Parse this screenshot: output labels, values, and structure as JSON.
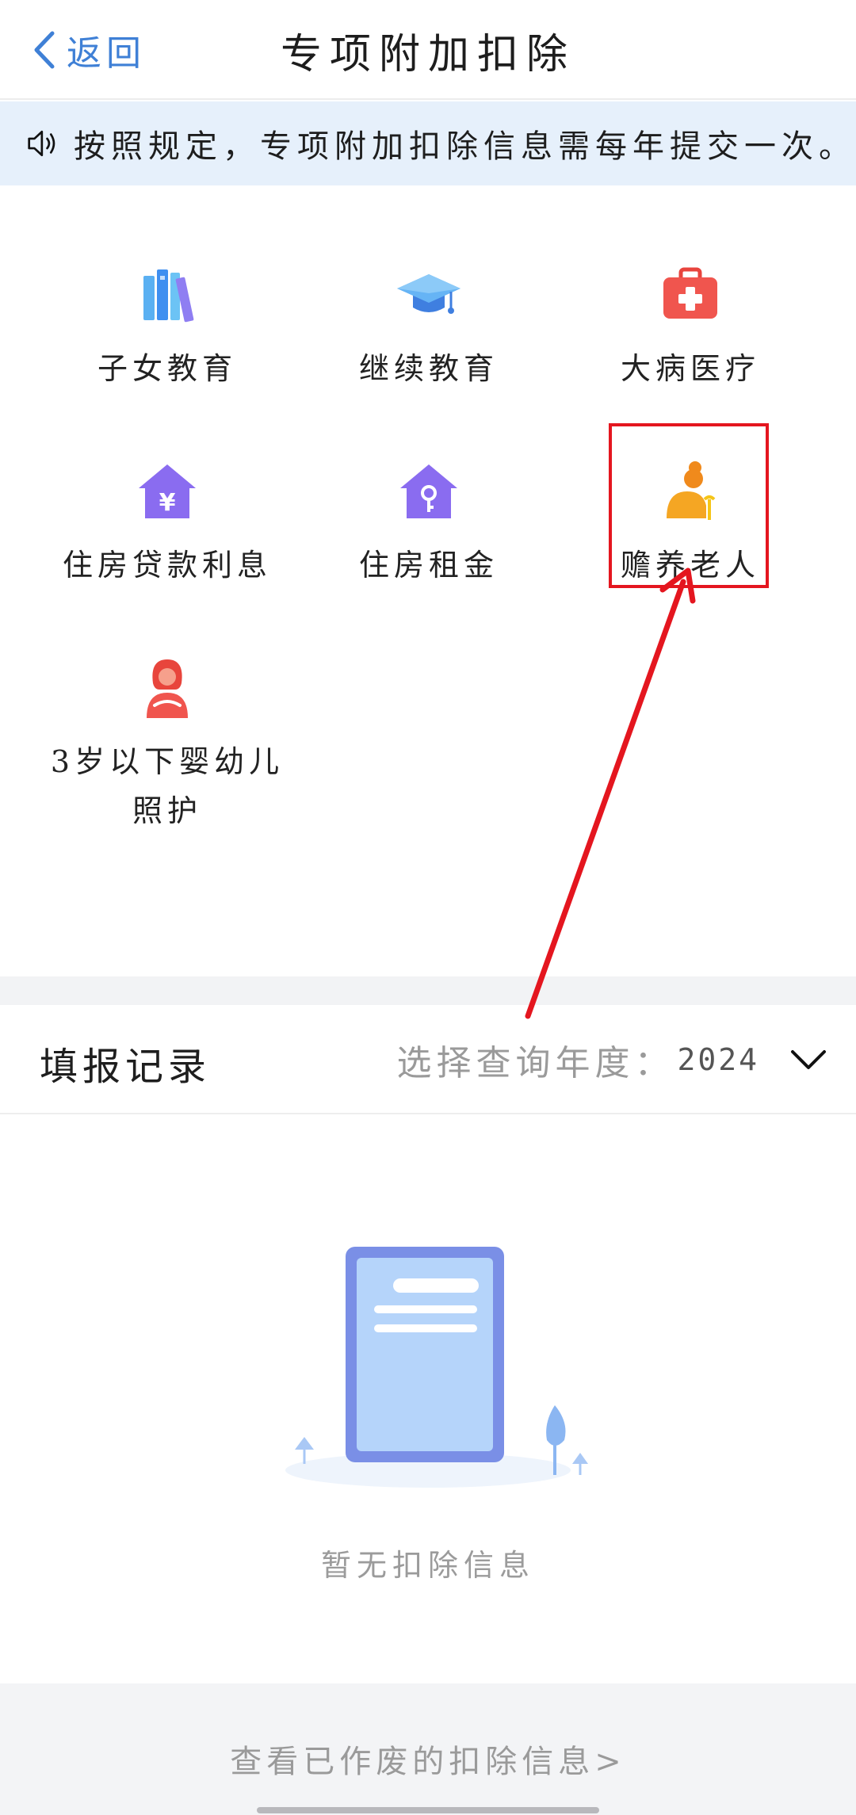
{
  "nav": {
    "back_label": "返回",
    "title": "专项附加扣除"
  },
  "notice": {
    "icon": "speaker-icon",
    "text": "按照规定，专项附加扣除信息需每年提交一次。"
  },
  "categories": [
    {
      "label": "子女教育",
      "icon": "books-icon",
      "color": "#4aa3f0"
    },
    {
      "label": "继续教育",
      "icon": "graduation-cap-icon",
      "color": "#4f8ff0"
    },
    {
      "label": "大病医疗",
      "icon": "medical-kit-icon",
      "color": "#f0554e"
    },
    {
      "label": "住房贷款利息",
      "icon": "house-yuan-icon",
      "color": "#8a6cf0"
    },
    {
      "label": "住房租金",
      "icon": "house-key-icon",
      "color": "#8a6cf0"
    },
    {
      "label": "赡养老人",
      "icon": "elderly-person-icon",
      "color": "#f5a623",
      "highlighted": true
    },
    {
      "label": "3岁以下婴幼儿照护",
      "icon": "mother-baby-icon",
      "color": "#f0554e"
    }
  ],
  "records": {
    "title": "填报记录",
    "year_label": "选择查询年度：",
    "year_value": "2024"
  },
  "empty": {
    "text": "暂无扣除信息"
  },
  "footer": {
    "link": "查看已作废的扣除信息>"
  },
  "colors": {
    "accent": "#3f80d6",
    "notice_bg": "#e6f0fb",
    "annotation_red": "#e4161f"
  }
}
